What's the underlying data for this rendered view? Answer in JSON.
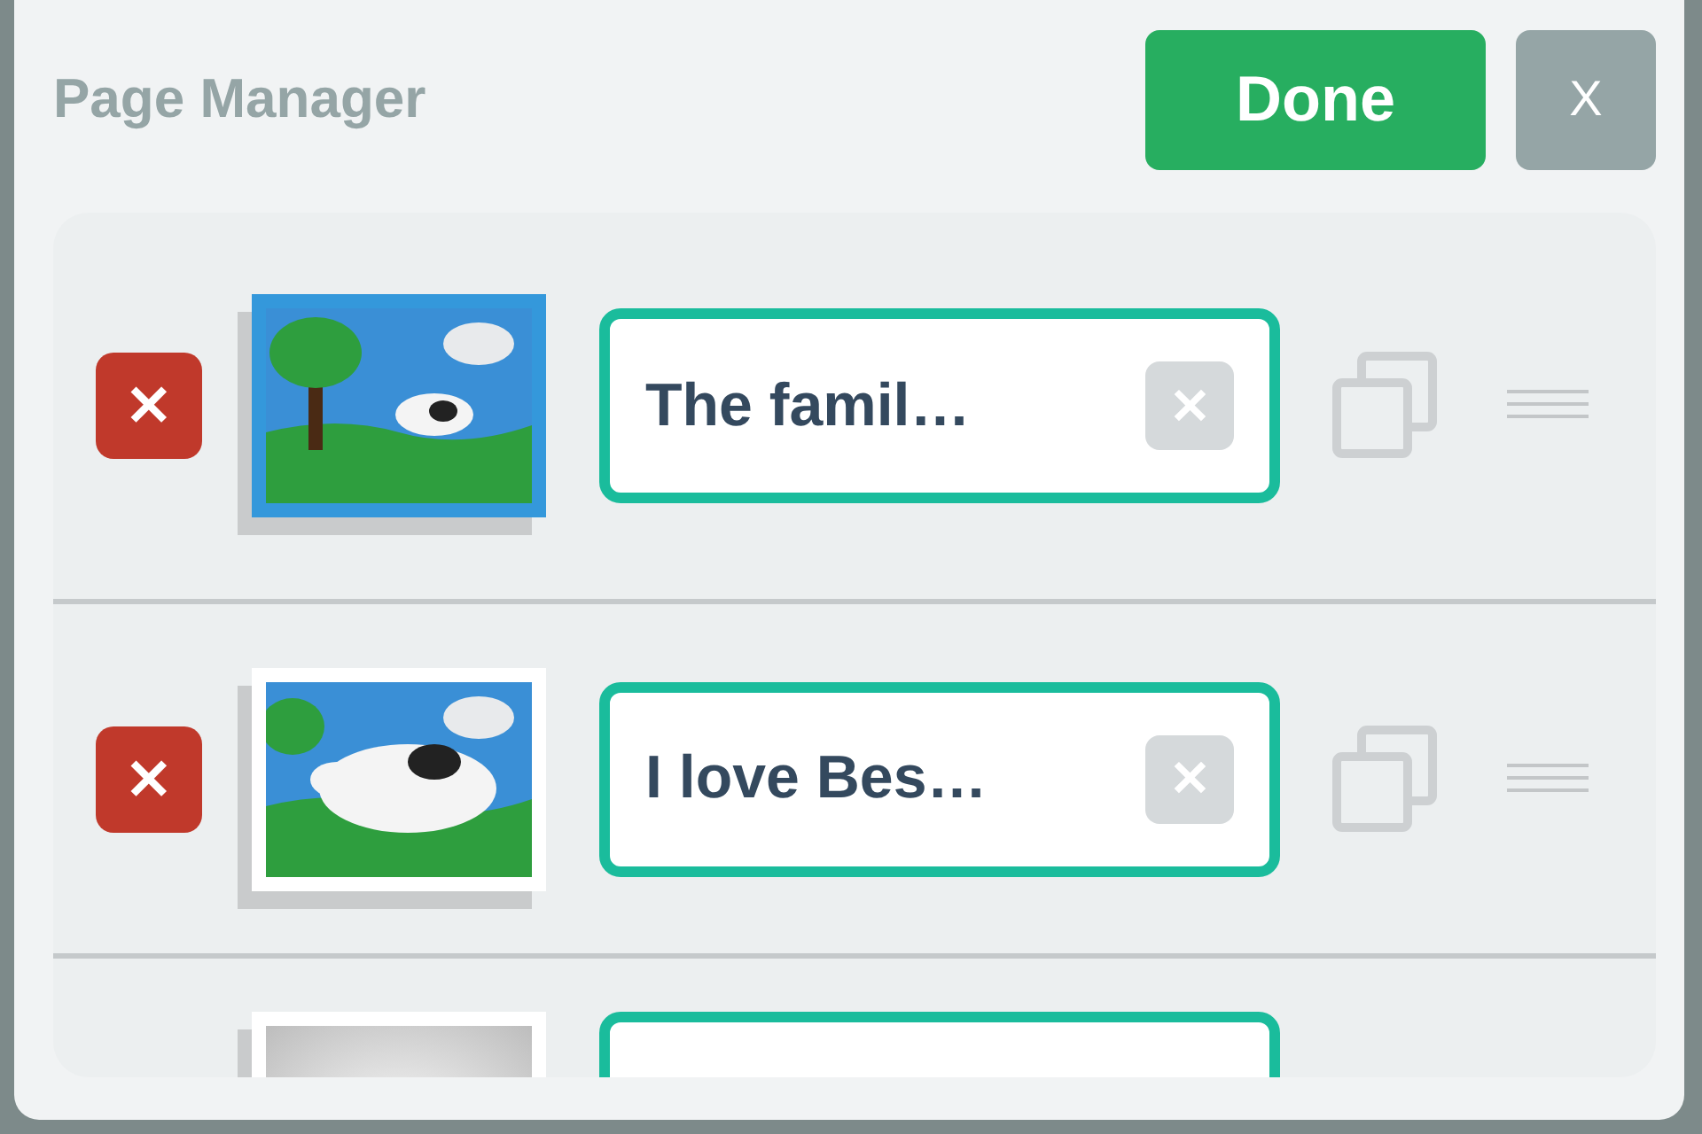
{
  "dialog": {
    "title": "Page Manager",
    "done_button": "Done",
    "close_button": "X"
  },
  "pages": [
    {
      "kind": "farm",
      "selected": true,
      "title": "The famil…",
      "delete_icon": "✕",
      "clear_icon": "✕"
    },
    {
      "kind": "cow",
      "selected": false,
      "title": "I love Bes…",
      "delete_icon": "✕",
      "clear_icon": "✕"
    },
    {
      "kind": "blank",
      "selected": false
    }
  ]
}
